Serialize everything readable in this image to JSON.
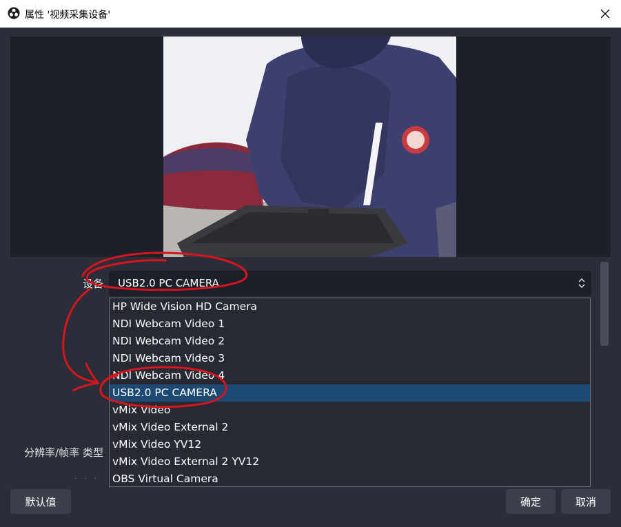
{
  "window": {
    "title": "属性 '视频采集设备'",
    "app_icon": "obs-logo-icon",
    "close_icon": "close-icon"
  },
  "form": {
    "device_label": "设备",
    "resolution_label": "分辨率/帧率 类型",
    "device_selected": "USB2.0 PC CAMERA"
  },
  "dropdown": {
    "items": [
      "HP Wide Vision HD Camera",
      "NDI Webcam Video 1",
      "NDI Webcam Video 2",
      "NDI Webcam Video 3",
      "NDI Webcam Video 4",
      "USB2.0 PC CAMERA",
      "vMix Video",
      "vMix Video External 2",
      "vMix Video YV12",
      "vMix Video External 2 YV12",
      "OBS Virtual Camera"
    ],
    "selected_index": 5
  },
  "buttons": {
    "defaults": "默认值",
    "ok": "确定",
    "cancel": "取消"
  },
  "colors": {
    "background": "#2b2e38",
    "selection": "#1c4a72",
    "annotation": "#d8141c"
  }
}
